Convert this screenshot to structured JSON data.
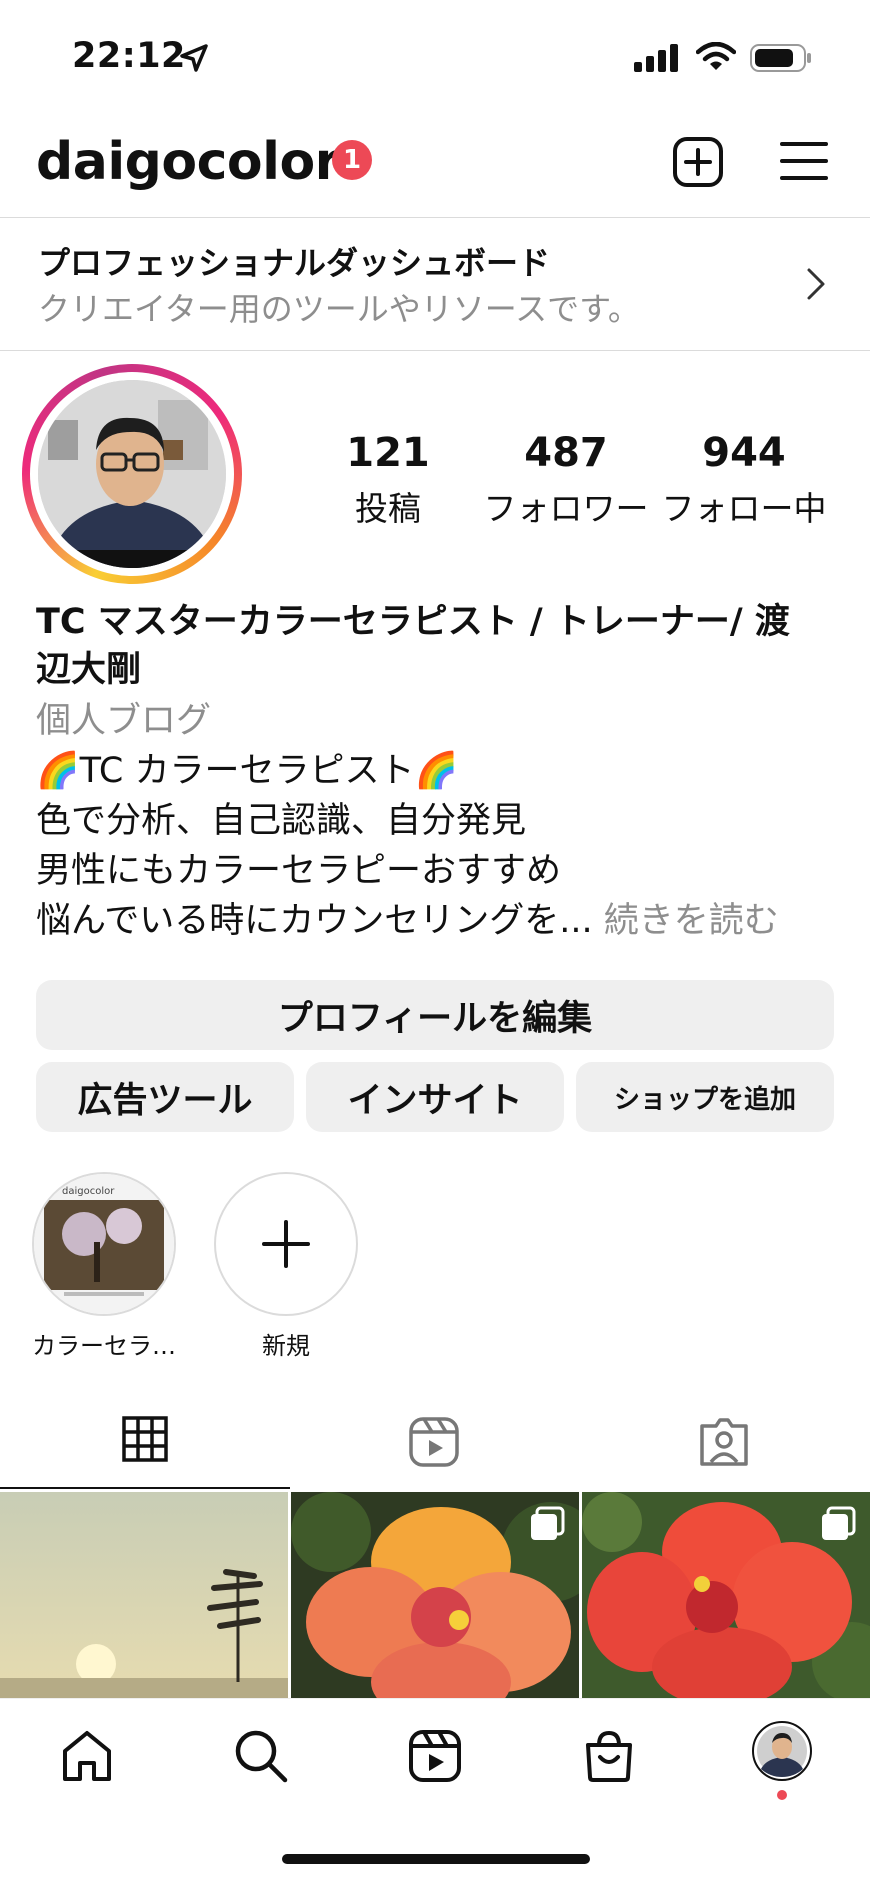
{
  "status_bar": {
    "time": "22:12"
  },
  "header": {
    "username": "daigocolor",
    "notification_count": "1"
  },
  "dashboard": {
    "title": "プロフェッショナルダッシュボード",
    "subtitle": "クリエイター用のツールやリソースです。"
  },
  "stats": [
    {
      "value": "121",
      "label": "投稿"
    },
    {
      "value": "487",
      "label": "フォロワー"
    },
    {
      "value": "944",
      "label": "フォロー中"
    }
  ],
  "bio": {
    "name_line1": "TC マスターカラーセラピスト / トレーナー/ 渡",
    "name_line2": "辺大剛",
    "category": "個人ブログ",
    "line1": "🌈TC カラーセラピスト🌈",
    "line2": "色で分析、自己認識、自分発見",
    "line3": "男性にもカラーセラピーおすすめ",
    "line4": "悩んでいる時にカウンセリングを...",
    "more": " 続きを読む"
  },
  "buttons": {
    "edit_profile": "プロフィールを編集",
    "ad_tools": "広告ツール",
    "insights": "インサイト",
    "add_shop": "ショップを追加"
  },
  "highlights": [
    {
      "label": "カラーセラ…",
      "thumb_caption": "daigocolor"
    },
    {
      "label": "新規"
    }
  ],
  "tabs": [
    {
      "icon": "grid-icon",
      "active": true
    },
    {
      "icon": "reels-icon",
      "active": false
    },
    {
      "icon": "tagged-icon",
      "active": false
    }
  ],
  "nav": [
    "home-icon",
    "search-icon",
    "reels-icon",
    "shop-icon",
    "profile-avatar"
  ]
}
